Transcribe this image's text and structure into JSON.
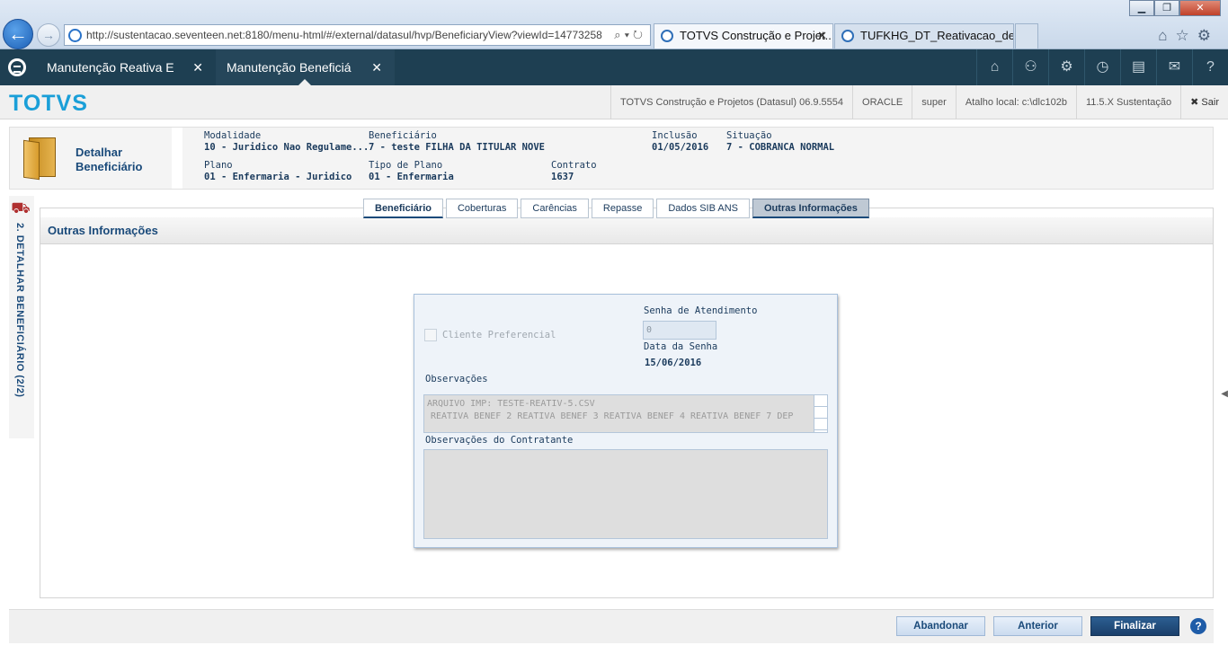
{
  "browser": {
    "url": "http://sustentacao.seventeen.net:8180/menu-html/#/external/datasul/hvp/BeneficiaryView?viewId=14773258",
    "tabs": [
      {
        "label": "TOTVS Construção e Projet...",
        "close": "✕"
      },
      {
        "label": "TUFKHG_DT_Reativacao_de_C...",
        "close": ""
      }
    ],
    "window_buttons": [
      "▁",
      "❐",
      "✕"
    ]
  },
  "app": {
    "tabs": [
      {
        "label": "Manutenção Reativa E",
        "close": "✕"
      },
      {
        "label": "Manutenção Beneficiá",
        "close": "✕"
      }
    ],
    "toolbar_icons": [
      "home-icon",
      "hierarchy-icon",
      "settings-icon",
      "clock-icon",
      "document-icon",
      "mail-icon",
      "help-icon"
    ]
  },
  "brandbar": {
    "brand": "TOTVS",
    "company": "TOTVS Construção e Projetos (Datasul) 06.9.5554",
    "db": "ORACLE",
    "user": "super",
    "shortcut": "Atalho local: c:\\dlc102b",
    "version": "11.5.X Sustentação",
    "exit": "✖ Sair"
  },
  "header": {
    "title_line1": "Detalhar",
    "title_line2": "Beneficiário",
    "modalidade": {
      "label": "Modalidade",
      "value": "10 - Juridico Nao Regulame..."
    },
    "beneficiario": {
      "label": "Beneficiário",
      "value": "7 - teste FILHA DA TITULAR NOVE"
    },
    "inclusao": {
      "label": "Inclusão",
      "value": "01/05/2016"
    },
    "situacao": {
      "label": "Situação",
      "value": "7 - COBRANCA NORMAL"
    },
    "plano": {
      "label": "Plano",
      "value": "01 - Enfermaria - Juridico"
    },
    "tipo_plano": {
      "label": "Tipo de Plano",
      "value": "01 - Enfermaria"
    },
    "contrato": {
      "label": "Contrato",
      "value": "1637"
    }
  },
  "side": {
    "label": "2. DETALHAR BENEFICIÁRIO (2/2)"
  },
  "tabs": [
    "Beneficiário",
    "Coberturas",
    "Carências",
    "Repasse",
    "Dados SIB ANS",
    "Outras Informações"
  ],
  "panel": {
    "title": "Outras Informações"
  },
  "form": {
    "cliente_preferencial": "Cliente Preferencial",
    "senha_label": "Senha de Atendimento",
    "senha_value": "0",
    "data_senha_label": "Data da Senha",
    "data_senha_value": "15/06/2016",
    "observacoes_label": "Observações",
    "observacoes_line1": "ARQUIVO IMP: TESTE-REATIV-5.CSV",
    "observacoes_line2": "REATIVA BENEF 2 REATIVA BENEF 3 REATIVA BENEF 4 REATIVA BENEF 7 DEP",
    "obs_contratante_label": "Observações do Contratante"
  },
  "footer": {
    "abandonar": "Abandonar",
    "anterior": "Anterior",
    "finalizar": "Finalizar",
    "help": "?"
  }
}
